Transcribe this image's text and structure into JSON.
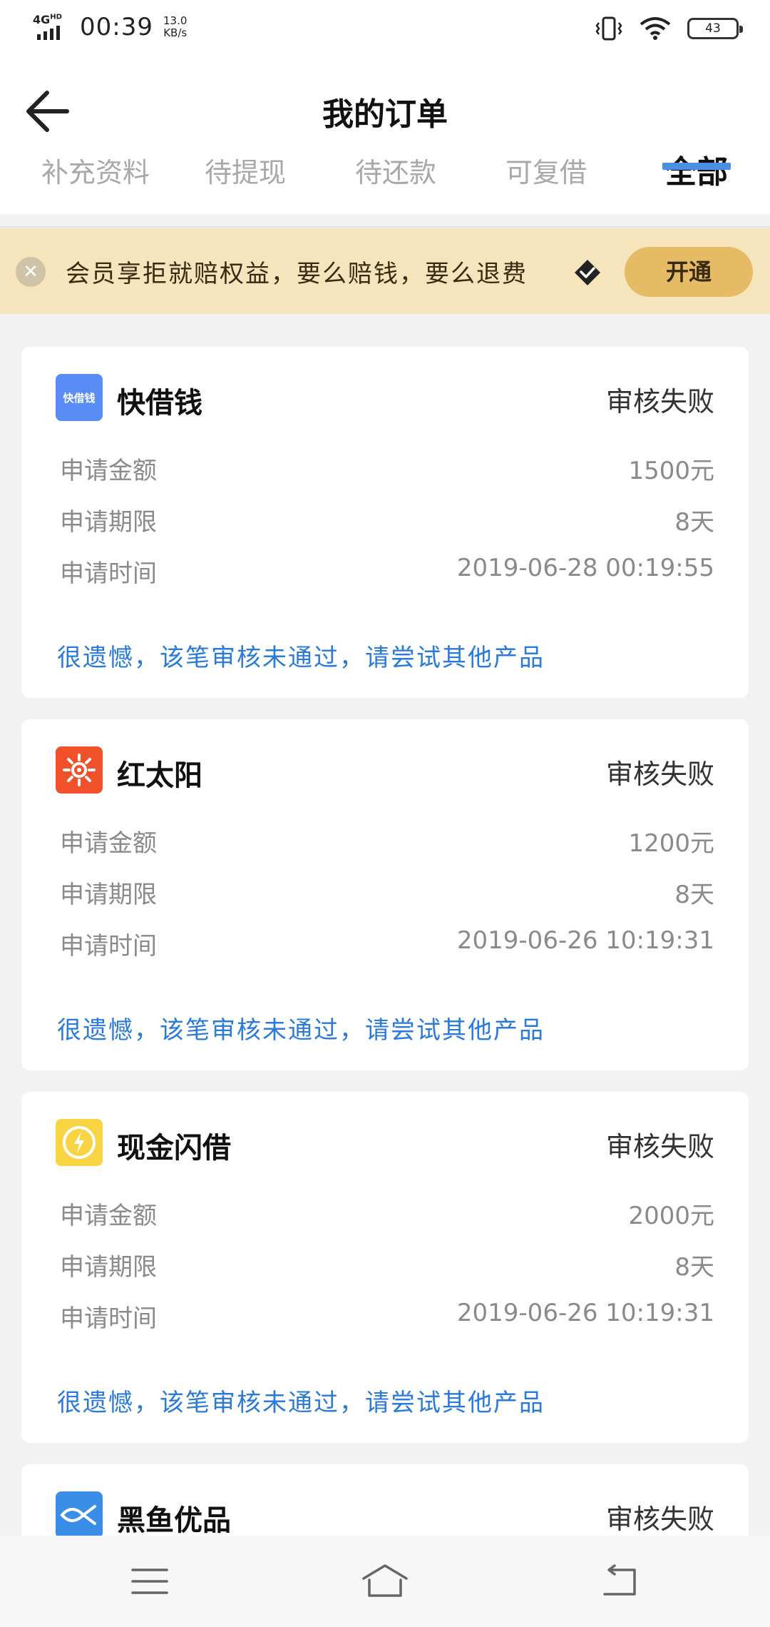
{
  "status_bar": {
    "network": "4G",
    "network_sup": "HD",
    "time": "00:39",
    "speed_value": "13.0",
    "speed_unit": "KB/s",
    "battery": "43"
  },
  "header": {
    "title": "我的订单"
  },
  "tabs": [
    {
      "label": "补充资料",
      "active": false
    },
    {
      "label": "待提现",
      "active": false
    },
    {
      "label": "待还款",
      "active": false
    },
    {
      "label": "可复借",
      "active": false
    },
    {
      "label": "全部",
      "active": true
    }
  ],
  "banner": {
    "text": "会员享拒就赔权益，要么赔钱，要么退费",
    "button": "开通"
  },
  "orders": [
    {
      "name": "快借钱",
      "logo_text": "快借钱",
      "logo_color": "#5a8cf5",
      "status": "审核失败",
      "rows": [
        {
          "label": "申请金额",
          "value": "1500元"
        },
        {
          "label": "申请期限",
          "value": "8天"
        },
        {
          "label": "申请时间",
          "value": "2019-06-28 00:19:55"
        }
      ],
      "message": "很遗憾，该笔审核未通过，请尝试其他产品"
    },
    {
      "name": "红太阳",
      "logo_color": "#f0502a",
      "status": "审核失败",
      "rows": [
        {
          "label": "申请金额",
          "value": "1200元"
        },
        {
          "label": "申请期限",
          "value": "8天"
        },
        {
          "label": "申请时间",
          "value": "2019-06-26 10:19:31"
        }
      ],
      "message": "很遗憾，该笔审核未通过，请尝试其他产品"
    },
    {
      "name": "现金闪借",
      "logo_color": "#f8d442",
      "status": "审核失败",
      "rows": [
        {
          "label": "申请金额",
          "value": "2000元"
        },
        {
          "label": "申请期限",
          "value": "8天"
        },
        {
          "label": "申请时间",
          "value": "2019-06-26 10:19:31"
        }
      ],
      "message": "很遗憾，该笔审核未通过，请尝试其他产品"
    },
    {
      "name": "黑鱼优品",
      "logo_color": "#3a8ee8",
      "status": "审核失败"
    }
  ],
  "icons": {
    "back": "arrow-left-icon",
    "close": "close-icon",
    "diamond": "diamond-icon",
    "menu": "menu-icon",
    "home": "home-icon",
    "return": "return-icon"
  },
  "colors": {
    "accent_blue": "#4a90e2",
    "banner_bg": "#f6e4bd",
    "button_gold": "#e6bb66",
    "message_blue": "#2a7ad9"
  }
}
